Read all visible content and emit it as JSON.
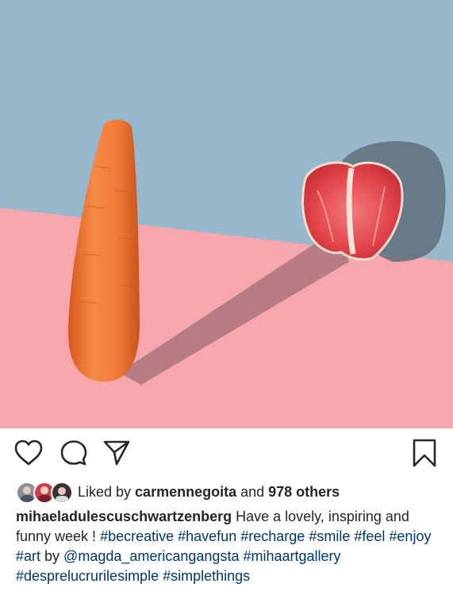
{
  "colors": {
    "sky": "#97b7cc",
    "floor": "#f5a7ad",
    "carrot": "#f07a36",
    "grapefruit": "#e2454a",
    "link": "#00376b",
    "text": "#262626"
  },
  "post": {
    "image_alt": "carrot and grapefruit still life"
  },
  "actions": {
    "like_icon": "heart-icon",
    "comment_icon": "comment-icon",
    "share_icon": "paper-plane-icon",
    "save_icon": "bookmark-icon"
  },
  "likes": {
    "prefix": "Liked by ",
    "user": "carmennegoita",
    "middle": " and ",
    "others": "978 others"
  },
  "caption": {
    "author": "mihaeladulescuschwartzenberg",
    "text": " Have a lovely, inspiring and funny week ! ",
    "tags": [
      "#becreative",
      "#havefun",
      "#recharge",
      "#smile",
      "#feel",
      "#enjoy",
      "#art"
    ],
    "by_text": " by ",
    "mention": "@magda_americangangsta",
    "tags2": [
      "#mihaartgallery",
      "#desprelucrurilesimple",
      "#simplethings"
    ]
  }
}
